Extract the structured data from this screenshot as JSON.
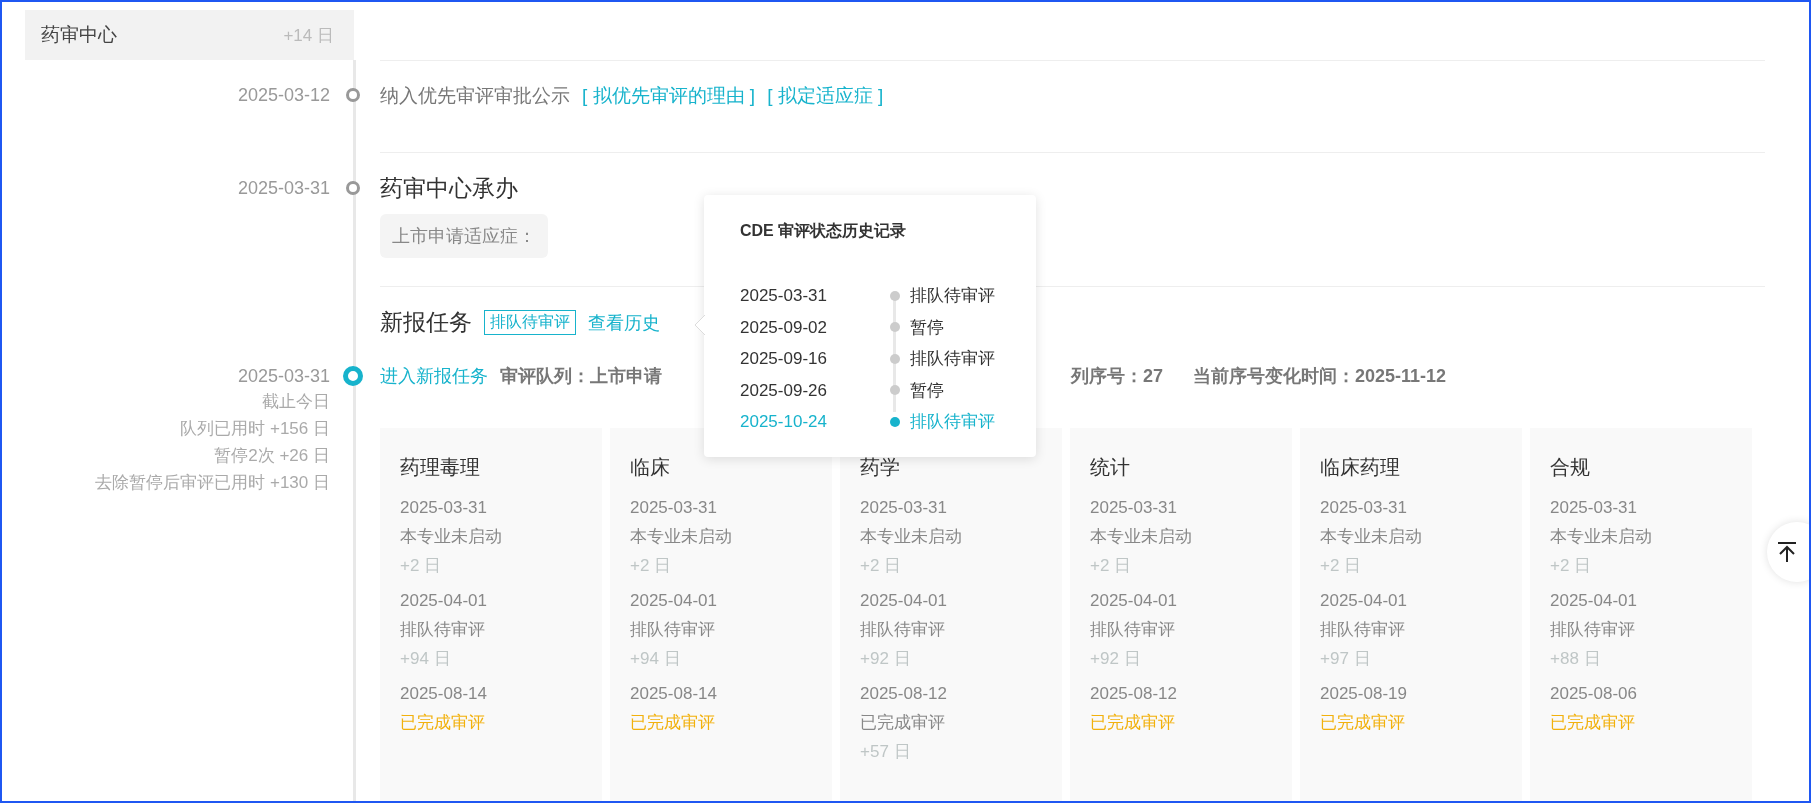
{
  "header": {
    "title": "药审中心",
    "duration": "+14 日"
  },
  "timeline": [
    {
      "kind": "notice",
      "date": "2025-03-12",
      "active": false,
      "text": "纳入优先审评审批公示",
      "links": [
        "[ 拟优先审评的理由 ]",
        "[ 拟定适应症 ]"
      ]
    },
    {
      "kind": "heading",
      "date": "2025-03-31",
      "active": false,
      "title": "药审中心承办",
      "chip": "上市申请适应症："
    }
  ],
  "task": {
    "title": "新报任务",
    "status_tag": "排队待审评",
    "history_link": "查看历史",
    "date": "2025-03-31",
    "active": true,
    "stats": [
      "截止今日",
      "队列已用时 +156 日",
      "暂停2次 +26 日",
      "去除暂停后审评已用时 +130 日"
    ],
    "enter_link": "进入新报任务",
    "info": [
      "审评队列：上市申请",
      "列序号：27",
      "当前序号变化时间：2025-11-12"
    ]
  },
  "history_popup": {
    "title": "CDE 审评状态历史记录",
    "entries": [
      {
        "date": "2025-03-31",
        "status": "排队待审评",
        "selected": false
      },
      {
        "date": "2025-09-02",
        "status": "暂停",
        "selected": false
      },
      {
        "date": "2025-09-16",
        "status": "排队待审评",
        "selected": false
      },
      {
        "date": "2025-09-26",
        "status": "暂停",
        "selected": false
      },
      {
        "date": "2025-10-24",
        "status": "排队待审评",
        "selected": true
      }
    ]
  },
  "review_cards": [
    {
      "title": "药理毒理",
      "steps": [
        {
          "date": "2025-03-31",
          "status": "本专业未启动",
          "done": false,
          "duration": "+2 日"
        },
        {
          "date": "2025-04-01",
          "status": "排队待审评",
          "done": false,
          "duration": "+94 日"
        },
        {
          "date": "2025-08-14",
          "status": "已完成审评",
          "done": true
        }
      ]
    },
    {
      "title": "临床",
      "steps": [
        {
          "date": "2025-03-31",
          "status": "本专业未启动",
          "done": false,
          "duration": "+2 日"
        },
        {
          "date": "2025-04-01",
          "status": "排队待审评",
          "done": false,
          "duration": "+94 日"
        },
        {
          "date": "2025-08-14",
          "status": "已完成审评",
          "done": true
        }
      ]
    },
    {
      "title": "药学",
      "steps": [
        {
          "date": "2025-03-31",
          "status": "本专业未启动",
          "done": false,
          "duration": "+2 日"
        },
        {
          "date": "2025-04-01",
          "status": "排队待审评",
          "done": false,
          "duration": "+92 日"
        },
        {
          "date": "2025-08-12",
          "status": "已完成审评",
          "done": false,
          "duration": "+57 日"
        }
      ]
    },
    {
      "title": "统计",
      "steps": [
        {
          "date": "2025-03-31",
          "status": "本专业未启动",
          "done": false,
          "duration": "+2 日"
        },
        {
          "date": "2025-04-01",
          "status": "排队待审评",
          "done": false,
          "duration": "+92 日"
        },
        {
          "date": "2025-08-12",
          "status": "已完成审评",
          "done": true
        }
      ]
    },
    {
      "title": "临床药理",
      "steps": [
        {
          "date": "2025-03-31",
          "status": "本专业未启动",
          "done": false,
          "duration": "+2 日"
        },
        {
          "date": "2025-04-01",
          "status": "排队待审评",
          "done": false,
          "duration": "+97 日"
        },
        {
          "date": "2025-08-19",
          "status": "已完成审评",
          "done": true
        }
      ]
    },
    {
      "title": "合规",
      "steps": [
        {
          "date": "2025-03-31",
          "status": "本专业未启动",
          "done": false,
          "duration": "+2 日"
        },
        {
          "date": "2025-04-01",
          "status": "排队待审评",
          "done": false,
          "duration": "+88 日"
        },
        {
          "date": "2025-08-06",
          "status": "已完成审评",
          "done": true
        }
      ]
    }
  ]
}
